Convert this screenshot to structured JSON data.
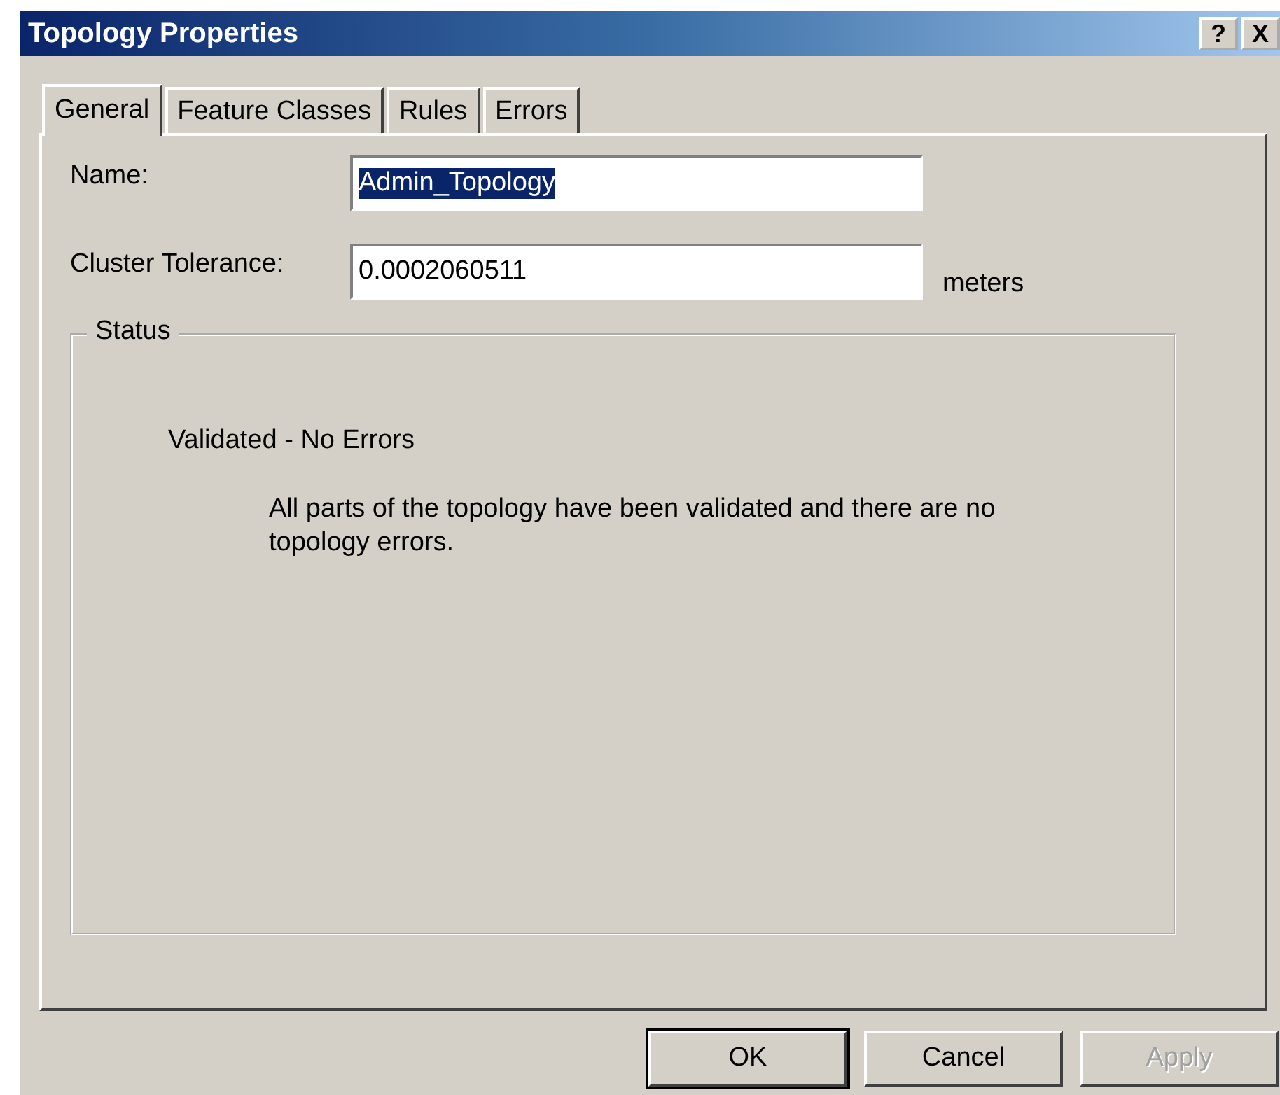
{
  "window": {
    "title": "Topology Properties",
    "title_buttons": [
      "?",
      "X"
    ]
  },
  "tabs": [
    {
      "label": "General",
      "selected": true
    },
    {
      "label": "Feature Classes",
      "selected": false
    },
    {
      "label": "Rules",
      "selected": false
    },
    {
      "label": "Errors",
      "selected": false
    }
  ],
  "fields": [
    {
      "label": "Name:",
      "value": "Admin_Topology",
      "selected": true
    },
    {
      "label": "Cluster Tolerance:",
      "value": "0.0002060511",
      "selected": false,
      "unit": "meters"
    }
  ],
  "status": {
    "title": "Status",
    "heading": "Validated - No Errors",
    "message": "All parts of the topology have been validated and there are no topology errors."
  },
  "buttons": [
    {
      "label": "OK",
      "disabled": false,
      "default": true
    },
    {
      "label": "Cancel",
      "disabled": false,
      "default": false
    },
    {
      "label": "Apply",
      "disabled": true,
      "default": false
    }
  ]
}
